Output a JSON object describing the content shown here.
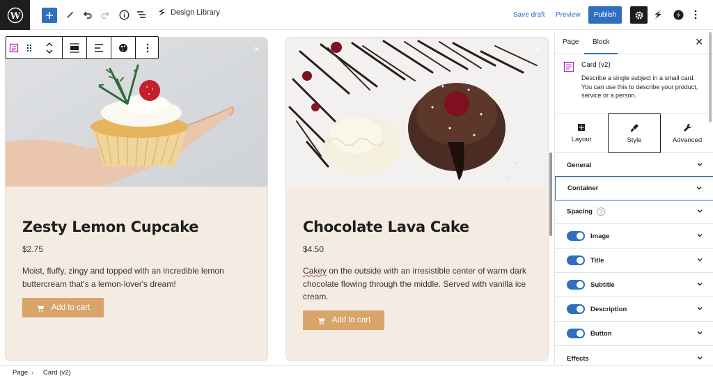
{
  "header": {
    "doc_title": "Design Library",
    "save_draft": "Save draft",
    "preview": "Preview",
    "publish": "Publish"
  },
  "cards": [
    {
      "title": "Zesty Lemon Cupcake",
      "price": "$2.75",
      "description": "Moist, fluffy, zingy and topped with an incredible lemon buttercream that's a lemon-lover's dream!",
      "button": "Add to cart"
    },
    {
      "title": "Chocolate Lava Cake",
      "price": "$4.50",
      "description_first_word": "Cakey",
      "description_rest": " on the outside with an irresistible center of warm dark chocolate flowing through the middle. Served with vanilla ice cream.",
      "button": "Add to cart"
    }
  ],
  "sidebar": {
    "tabs": [
      "Page",
      "Block"
    ],
    "block_name": "Card (v2)",
    "block_description": "Describe a single subject in a small card. You can use this to describe your product, service or a person.",
    "style_tabs": [
      "Layout",
      "Style",
      "Advanced"
    ],
    "panels": {
      "general": "General",
      "container": "Container",
      "spacing": "Spacing",
      "image": "Image",
      "title": "Title",
      "subtitle": "Subtitle",
      "description": "Description",
      "button": "Button",
      "effects": "Effects"
    },
    "help": "?"
  },
  "breadcrumb": {
    "page": "Page",
    "current": "Card (v2)"
  },
  "colors": {
    "accent": "#2f6fc0",
    "card_bg": "#f4ece2",
    "cart_button": "#d9a46a"
  }
}
